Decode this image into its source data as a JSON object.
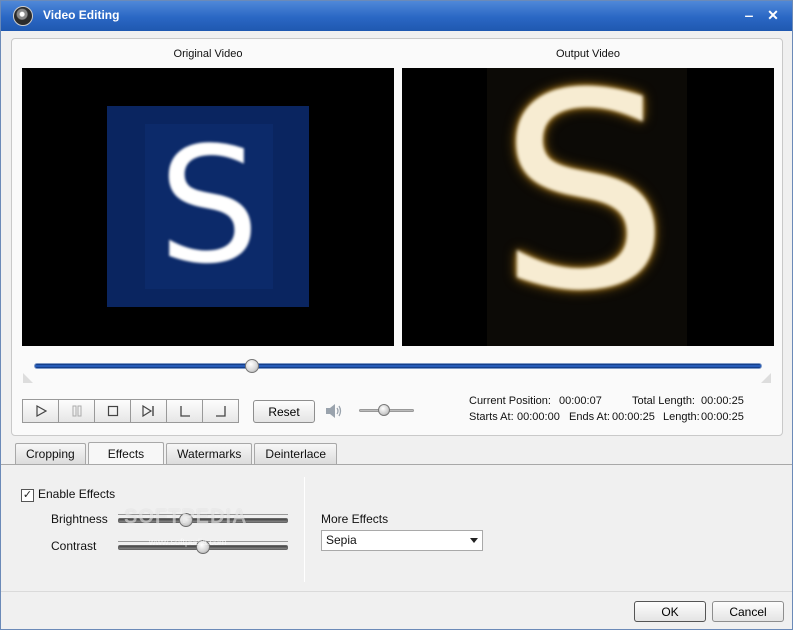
{
  "window": {
    "title": "Video Editing",
    "minimize": "‒",
    "close": "✕"
  },
  "preview": {
    "original_label": "Original Video",
    "output_label": "Output Video",
    "frame_letter": "S",
    "seek_fraction": 0.3,
    "output_effect": "sepia"
  },
  "controls": {
    "reset_label": "Reset",
    "volume_fraction": 0.45,
    "buttons": [
      "play",
      "pause",
      "stop",
      "next-frame",
      "set-start",
      "set-end"
    ]
  },
  "info": {
    "current_position_label": "Current Position:",
    "current_position": "00:00:07",
    "total_length_label": "Total Length:",
    "total_length": "00:00:25",
    "starts_at_label": "Starts At:",
    "starts_at": "00:00:00",
    "ends_at_label": "Ends At:",
    "ends_at": "00:00:25",
    "length_label": "Length:",
    "length": "00:00:25"
  },
  "tabs": [
    "Cropping",
    "Effects",
    "Watermarks",
    "Deinterlace"
  ],
  "active_tab": "Effects",
  "effects": {
    "enable_label": "Enable Effects",
    "enabled": true,
    "brightness_label": "Brightness",
    "brightness_fraction": 0.4,
    "contrast_label": "Contrast",
    "contrast_fraction": 0.5,
    "more_effects_label": "More Effects",
    "more_effects_value": "Sepia"
  },
  "watermark": {
    "text": "SOFTPEDIA",
    "sub": "www.softpedia.com"
  },
  "footer": {
    "ok_label": "OK",
    "cancel_label": "Cancel"
  },
  "colors": {
    "titlebar": "#2a67c4",
    "seek_track": "#2e6ad0",
    "original_bg": "#0a2560",
    "sepia_glow": "#c9962a"
  }
}
